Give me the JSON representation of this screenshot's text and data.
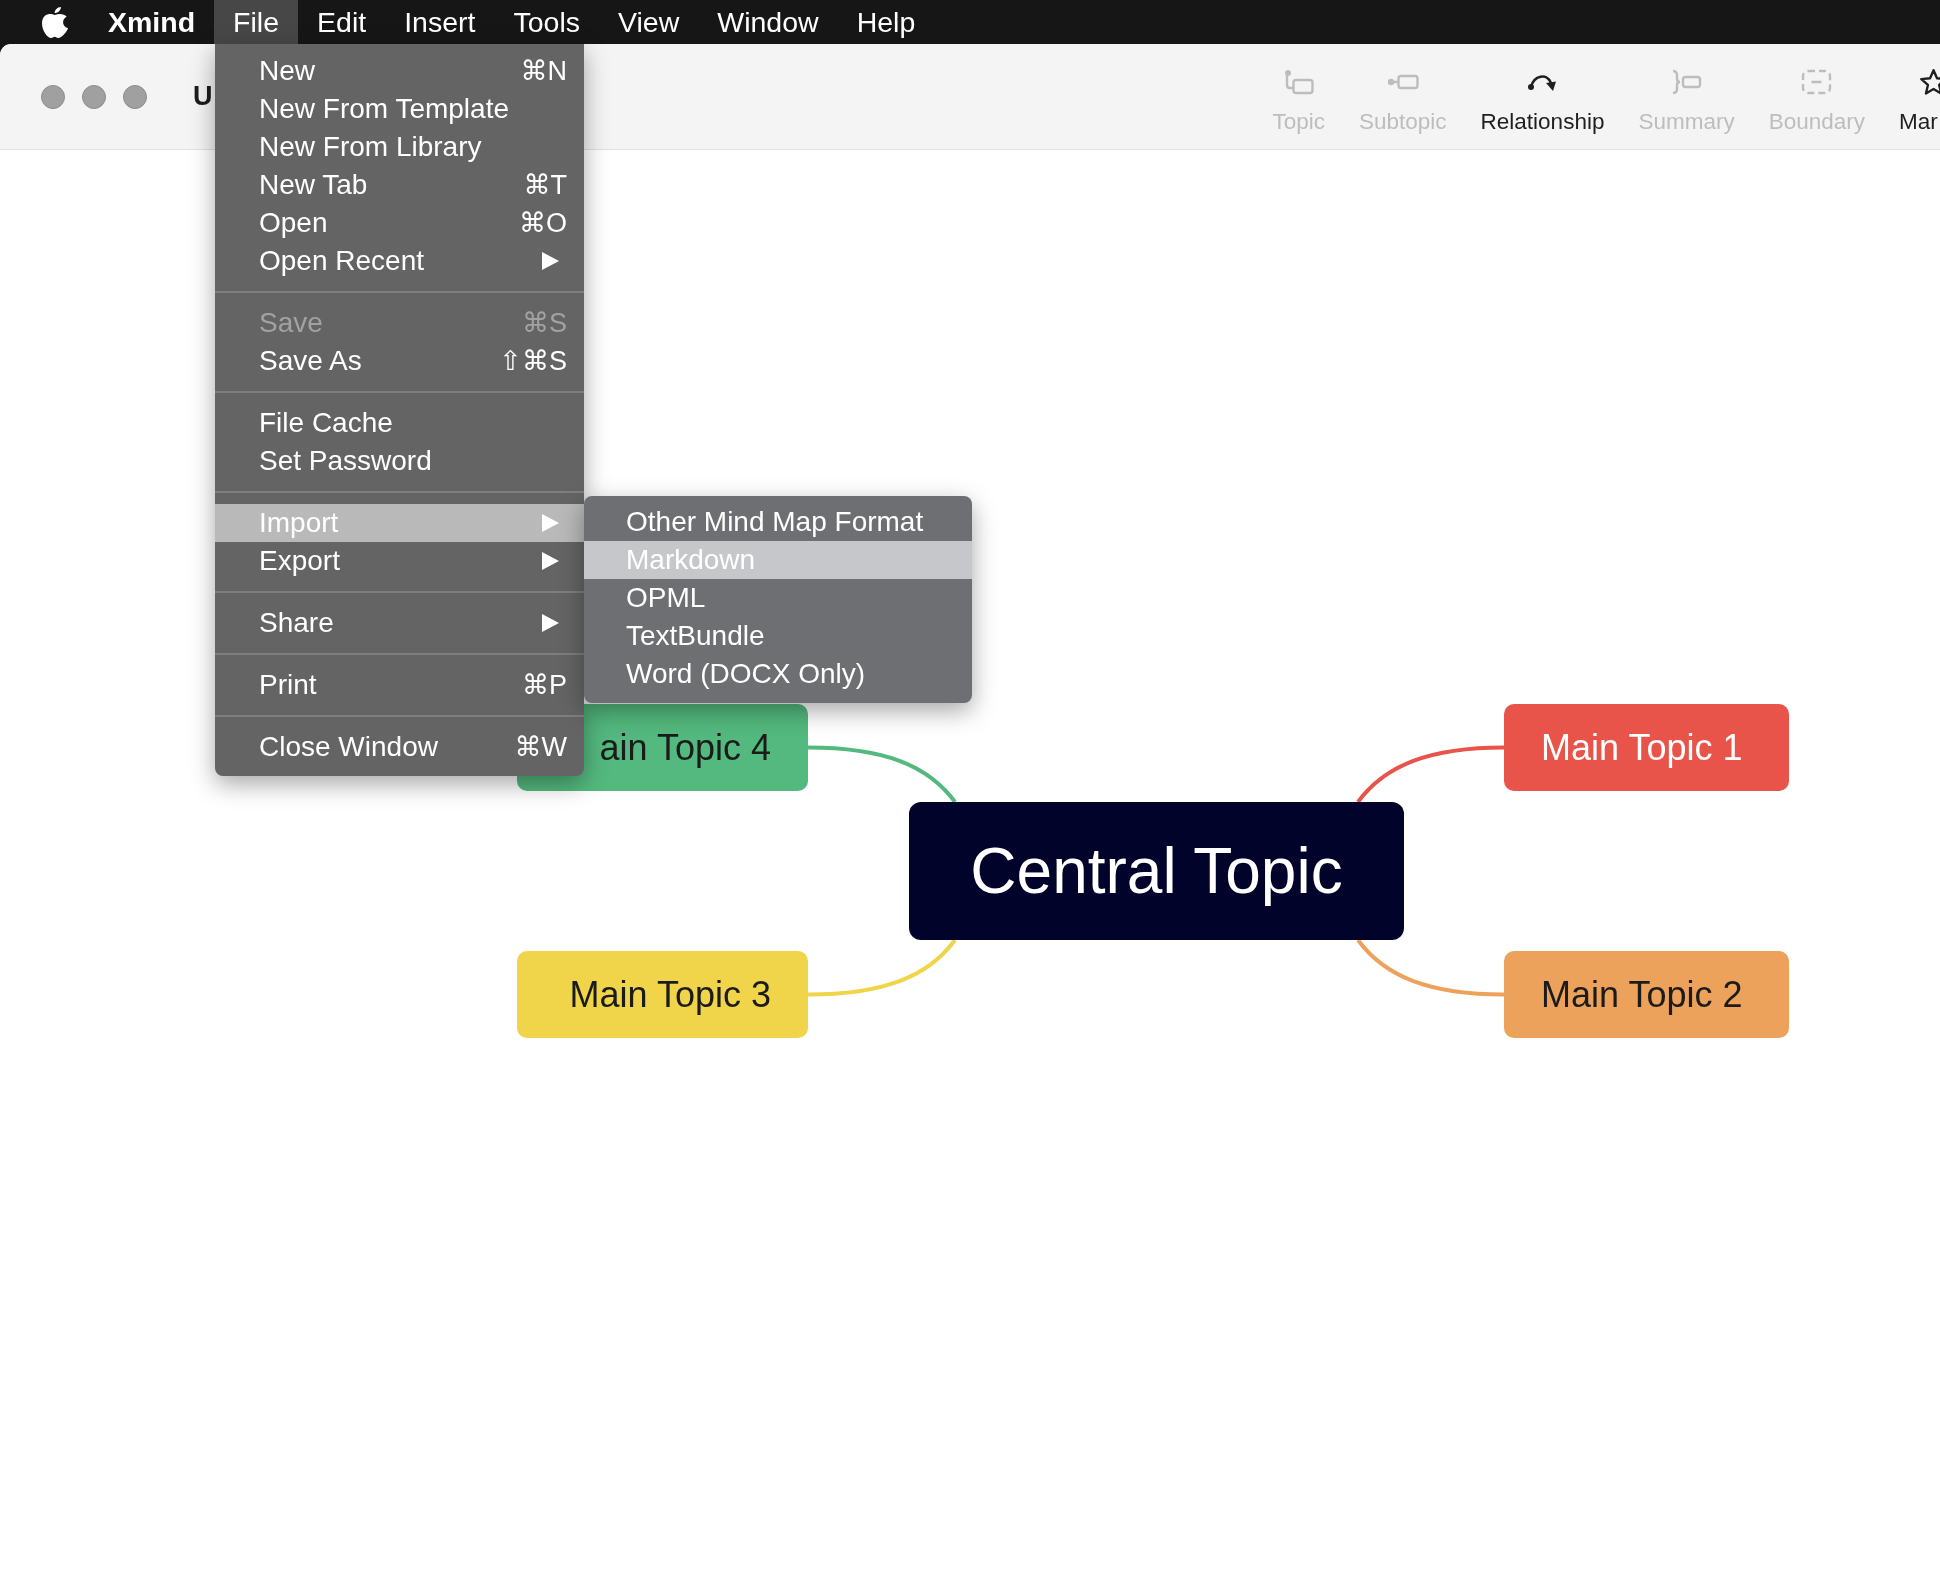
{
  "menu_bar": {
    "app_name": "Xmind",
    "menus": [
      {
        "label": "File",
        "selected": true
      },
      {
        "label": "Edit",
        "selected": false
      },
      {
        "label": "Insert",
        "selected": false
      },
      {
        "label": "Tools",
        "selected": false
      },
      {
        "label": "View",
        "selected": false
      },
      {
        "label": "Window",
        "selected": false
      },
      {
        "label": "Help",
        "selected": false
      }
    ]
  },
  "window": {
    "title": "U"
  },
  "toolbar": [
    {
      "kind": "topic",
      "label": "Topic",
      "disabled": true
    },
    {
      "kind": "subtopic",
      "label": "Subtopic",
      "disabled": true
    },
    {
      "kind": "relationship",
      "label": "Relationship",
      "disabled": false
    },
    {
      "kind": "summary",
      "label": "Summary",
      "disabled": true
    },
    {
      "kind": "boundary",
      "label": "Boundary",
      "disabled": true
    },
    {
      "kind": "marker",
      "label": "Mar",
      "disabled": false
    }
  ],
  "file_menu": {
    "groups": [
      {
        "items": [
          {
            "label": "New",
            "shortcut": "⌘N",
            "submenu": false,
            "disabled": false,
            "selected": false
          },
          {
            "label": "New From Template",
            "submenu": false,
            "disabled": false,
            "selected": false
          },
          {
            "label": "New From Library",
            "submenu": false,
            "disabled": false,
            "selected": false
          },
          {
            "label": "New Tab",
            "shortcut": "⌘T",
            "submenu": false,
            "disabled": false,
            "selected": false
          },
          {
            "label": "Open",
            "shortcut": "⌘O",
            "submenu": false,
            "disabled": false,
            "selected": false
          },
          {
            "label": "Open Recent",
            "submenu": true,
            "disabled": false,
            "selected": false
          }
        ]
      },
      {
        "items": [
          {
            "label": "Save",
            "shortcut": "⌘S",
            "submenu": false,
            "disabled": true,
            "selected": false
          },
          {
            "label": "Save As",
            "shortcut": "⇧⌘S",
            "submenu": false,
            "disabled": false,
            "selected": false
          }
        ]
      },
      {
        "items": [
          {
            "label": "File Cache",
            "submenu": false,
            "disabled": false,
            "selected": false
          },
          {
            "label": "Set Password",
            "submenu": false,
            "disabled": false,
            "selected": false
          }
        ]
      },
      {
        "items": [
          {
            "label": "Import",
            "submenu": true,
            "disabled": false,
            "selected": true
          },
          {
            "label": "Export",
            "submenu": true,
            "disabled": false,
            "selected": false
          }
        ]
      },
      {
        "items": [
          {
            "label": "Share",
            "submenu": true,
            "disabled": false,
            "selected": false
          }
        ]
      },
      {
        "items": [
          {
            "label": "Print",
            "shortcut": "⌘P",
            "submenu": false,
            "disabled": false,
            "selected": false
          }
        ]
      },
      {
        "items": [
          {
            "label": "Close Window",
            "shortcut": "⌘W",
            "submenu": false,
            "disabled": false,
            "selected": false
          }
        ]
      }
    ]
  },
  "import_submenu": {
    "items": [
      {
        "label": "Other Mind Map Format",
        "selected": false
      },
      {
        "label": "Markdown",
        "selected": true
      },
      {
        "label": "OPML",
        "selected": false
      },
      {
        "label": "TextBundle",
        "selected": false
      },
      {
        "label": "Word (DOCX Only)",
        "selected": false
      }
    ]
  },
  "mind_map": {
    "central_topic": {
      "label": "Central Topic"
    },
    "main_topics": [
      {
        "label": "ain Topic 4",
        "color": "#53b97e"
      },
      {
        "label": "Main Topic 1",
        "color": "#e8534a"
      },
      {
        "label": "Main Topic 3",
        "color": "#f0d44a"
      },
      {
        "label": "Main Topic 2",
        "color": "#eca25b"
      }
    ]
  }
}
